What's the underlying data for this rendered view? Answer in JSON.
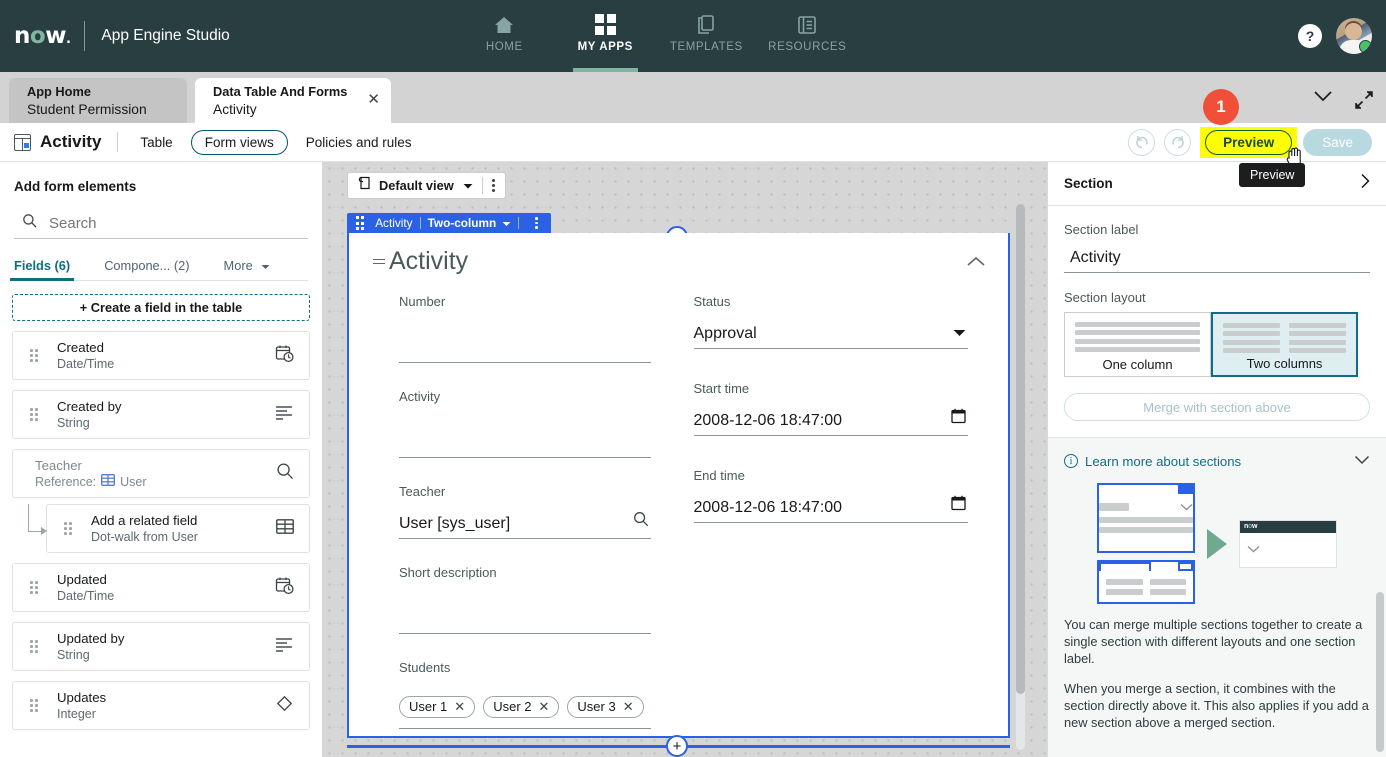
{
  "topnav": {
    "brand": "now",
    "app_title": "App Engine Studio",
    "items": [
      {
        "label": "HOME",
        "icon": "home-icon",
        "active": false
      },
      {
        "label": "MY APPS",
        "icon": "grid-icon",
        "active": true
      },
      {
        "label": "TEMPLATES",
        "icon": "templates-icon",
        "active": false
      },
      {
        "label": "RESOURCES",
        "icon": "resources-icon",
        "active": false
      }
    ],
    "help_label": "?",
    "avatar_name": "user-avatar"
  },
  "tabs": [
    {
      "title": "App Home",
      "subtitle": "Student Permission",
      "active": false
    },
    {
      "title": "Data Table And Forms",
      "subtitle": "Activity",
      "active": true
    }
  ],
  "annotation": {
    "badge": "1"
  },
  "actionbar": {
    "title": "Activity",
    "links": [
      "Table",
      "Form views",
      "Policies and rules"
    ],
    "undo_label": "undo-icon",
    "redo_label": "redo-icon",
    "preview_label": "Preview",
    "save_label": "Save",
    "tooltip": "Preview"
  },
  "leftpanel": {
    "title": "Add form elements",
    "search_placeholder": "Search",
    "search_value": "",
    "tabs": [
      {
        "label": "Fields (6)",
        "active": true
      },
      {
        "label": "Compone...  (2)",
        "active": false
      },
      {
        "label": "More",
        "active": false
      }
    ],
    "create_field_label": "+ Create a field in the table",
    "fields": [
      {
        "name": "Created",
        "type": "Date/Time",
        "icon": "date-time-icon"
      },
      {
        "name": "Created by",
        "type": "String",
        "icon": "string-icon"
      },
      {
        "name": "Teacher",
        "type": "Reference:  User",
        "icon": "reference-icon",
        "muted": true
      },
      {
        "name": "Add a related field",
        "type": "Dot-walk from User",
        "icon": "table-icon",
        "nested": true
      },
      {
        "name": "Updated",
        "type": "Date/Time",
        "icon": "date-time-icon"
      },
      {
        "name": "Updated by",
        "type": "String",
        "icon": "string-icon"
      },
      {
        "name": "Updates",
        "type": "Integer",
        "icon": "integer-icon"
      }
    ]
  },
  "canvas": {
    "view_name": "Default view",
    "section_chip": "Activity",
    "section_layout_chip": "Two-column",
    "section_title": "Activity",
    "left_fields": [
      {
        "label": "Number",
        "value": "",
        "control": "text"
      },
      {
        "label": "Activity",
        "value": "",
        "control": "text"
      },
      {
        "label": "Teacher",
        "value": "User [sys_user]",
        "control": "reference"
      },
      {
        "label": "Short description",
        "value": "",
        "control": "textarea"
      },
      {
        "label": "Students",
        "value": "",
        "control": "chips",
        "chips": [
          "User 1",
          "User 2",
          "User 3"
        ]
      }
    ],
    "right_fields": [
      {
        "label": "Status",
        "value": "Approval",
        "control": "select"
      },
      {
        "label": "Start time",
        "value": "2008-12-06 18:47:00",
        "control": "datetime"
      },
      {
        "label": "End time",
        "value": "2008-12-06 18:47:00",
        "control": "datetime"
      }
    ],
    "add_label": "+"
  },
  "rightpanel": {
    "header": "Section",
    "section_label_caption": "Section label",
    "section_label_value": "Activity",
    "section_layout_caption": "Section layout",
    "layout_options": [
      {
        "label": "One column",
        "selected": false
      },
      {
        "label": "Two columns",
        "selected": true
      }
    ],
    "merge_label": "Merge with section above",
    "learn_title": "Learn more about sections",
    "learn_paragraphs": [
      "You can merge multiple sections together to create a single section with different layouts and one section label.",
      "When you merge a section, it combines with the section directly above it. This also applies if you add a new section above a merged section."
    ],
    "art_now_label": "now"
  },
  "colors": {
    "brand_dark": "#293e40",
    "brand_green": "#81b5a1",
    "accent_teal": "#0f6e80",
    "section_blue": "#2b62e3",
    "highlight_yellow": "#ffff00",
    "badge_red": "#f0503a"
  }
}
